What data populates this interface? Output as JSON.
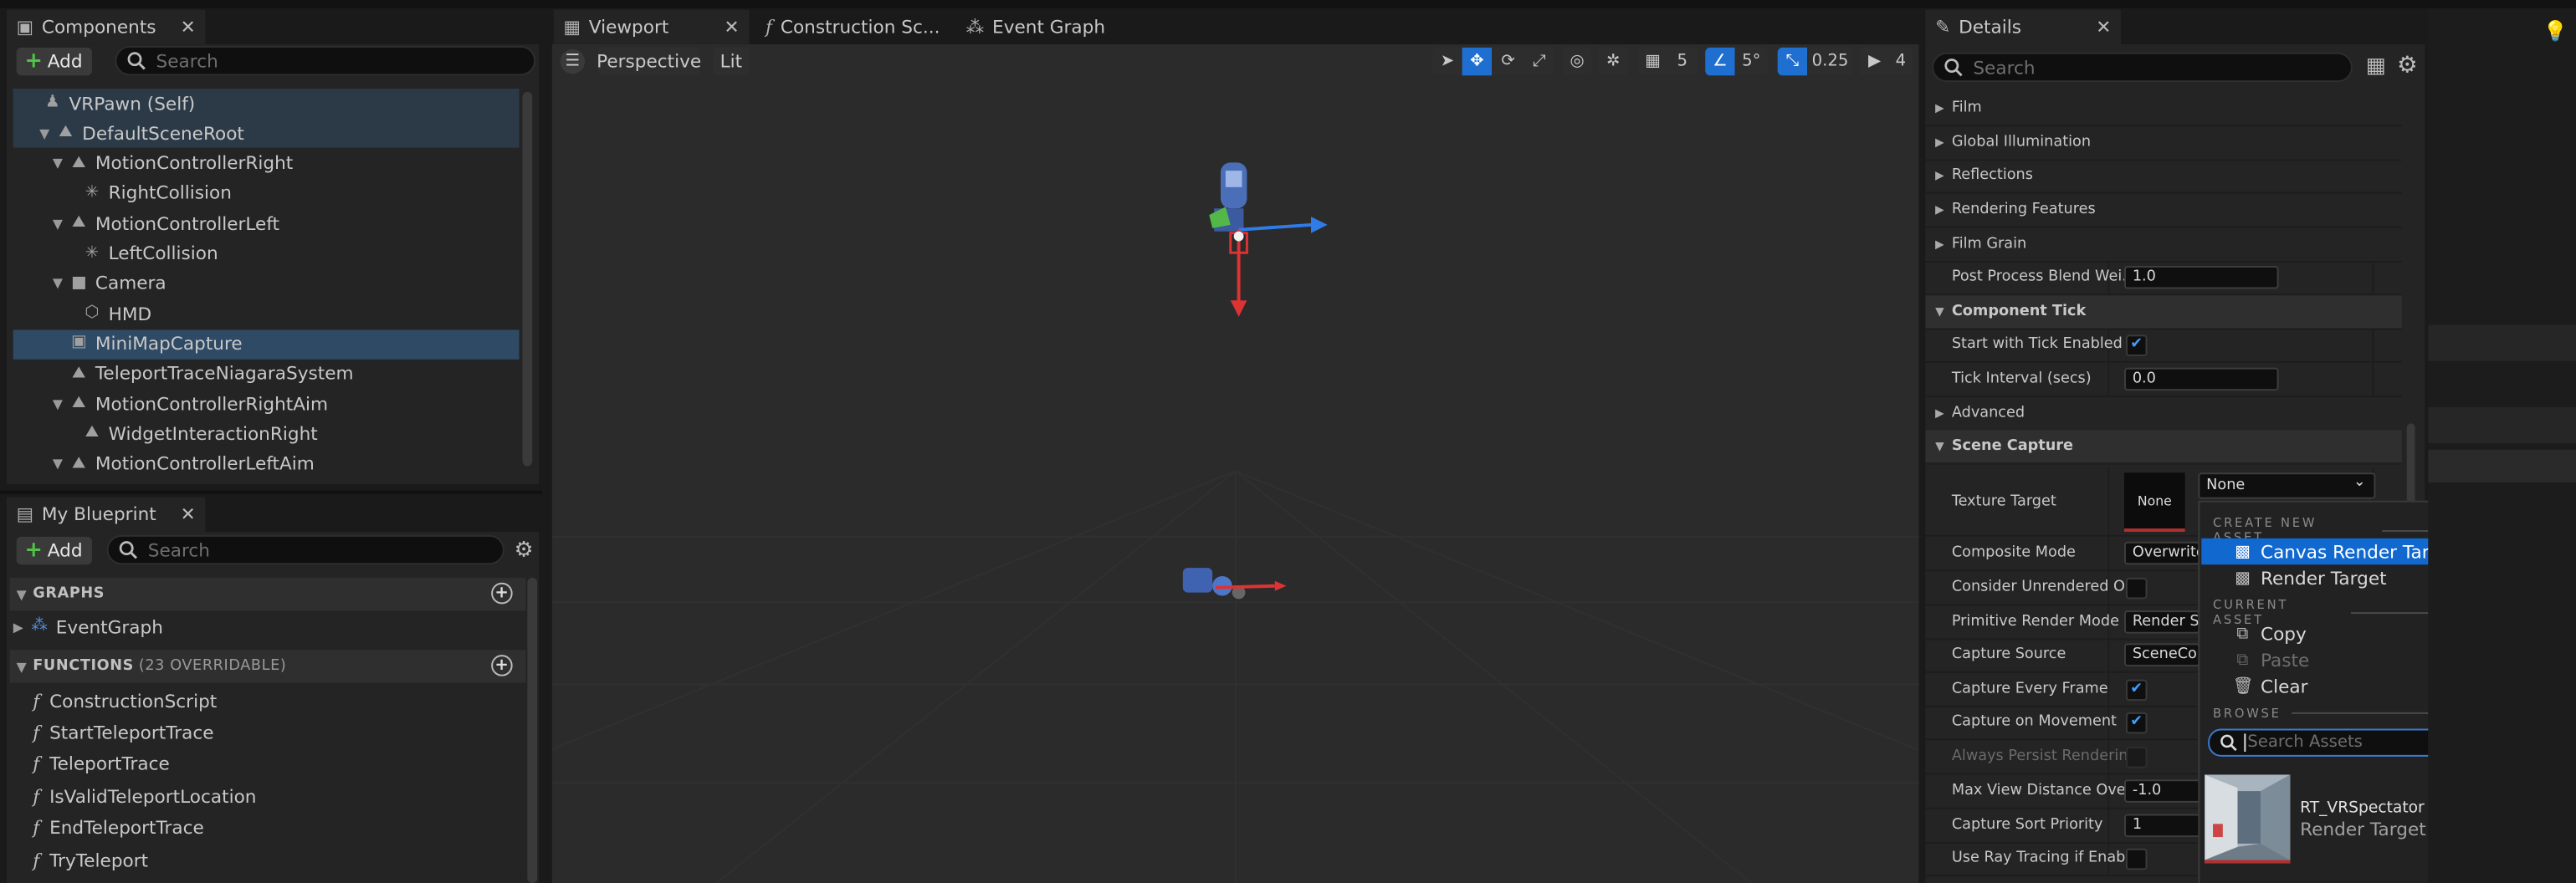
{
  "tabs": {
    "components": "Components",
    "viewport": "Viewport",
    "construction": "Construction Sc...",
    "event_graph": "Event Graph",
    "details": "Details",
    "my_blueprint": "My Blueprint"
  },
  "components_panel": {
    "add_label": "Add",
    "search_placeholder": "Search",
    "tree": [
      {
        "label": "VRPawn (Self)",
        "indent": 0,
        "icon": "pawn-icon",
        "arrow": ""
      },
      {
        "label": "DefaultSceneRoot",
        "indent": 1,
        "icon": "scene-icon",
        "arrow": "down"
      },
      {
        "label": "MotionControllerRight",
        "indent": 2,
        "icon": "motion-controller-icon",
        "arrow": "down"
      },
      {
        "label": "RightCollision",
        "indent": 3,
        "icon": "collision-icon",
        "arrow": ""
      },
      {
        "label": "MotionControllerLeft",
        "indent": 2,
        "icon": "motion-controller-icon",
        "arrow": "down"
      },
      {
        "label": "LeftCollision",
        "indent": 3,
        "icon": "collision-icon",
        "arrow": ""
      },
      {
        "label": "Camera",
        "indent": 2,
        "icon": "camera-icon",
        "arrow": "down"
      },
      {
        "label": "HMD",
        "indent": 3,
        "icon": "mesh-icon",
        "arrow": ""
      },
      {
        "label": "MiniMapCapture",
        "indent": 2,
        "icon": "scene-capture-icon",
        "arrow": "",
        "selected": true
      },
      {
        "label": "TeleportTraceNiagaraSystem",
        "indent": 2,
        "icon": "niagara-icon",
        "arrow": ""
      },
      {
        "label": "MotionControllerRightAim",
        "indent": 2,
        "icon": "motion-controller-icon",
        "arrow": "down"
      },
      {
        "label": "WidgetInteractionRight",
        "indent": 3,
        "icon": "widget-icon",
        "arrow": ""
      },
      {
        "label": "MotionControllerLeftAim",
        "indent": 2,
        "icon": "motion-controller-icon",
        "arrow": "down"
      }
    ]
  },
  "my_blueprint": {
    "add_label": "Add",
    "search_placeholder": "Search",
    "graphs_header": "GRAPHS",
    "event_graph": "EventGraph",
    "functions_header": "FUNCTIONS",
    "functions_count": "(23 OVERRIDABLE)",
    "functions": [
      "ConstructionScript",
      "StartTeleportTrace",
      "TeleportTrace",
      "IsValidTeleportLocation",
      "EndTeleportTrace",
      "TryTeleport"
    ]
  },
  "viewport": {
    "perspective": "Perspective",
    "lit": "Lit",
    "grid_value": "5",
    "angle_value": "5°",
    "scale_value": "0.25",
    "camera_speed": "4"
  },
  "details": {
    "search_placeholder": "Search",
    "rows": [
      {
        "type": "category",
        "label": "Film",
        "arrow": "right"
      },
      {
        "type": "category",
        "label": "Global Illumination",
        "arrow": "right"
      },
      {
        "type": "category",
        "label": "Reflections",
        "arrow": "right"
      },
      {
        "type": "category",
        "label": "Rendering Features",
        "arrow": "right"
      },
      {
        "type": "category",
        "label": "Film Grain",
        "arrow": "right"
      },
      {
        "type": "field",
        "label": "Post Process Blend Wei...",
        "value": "1.0"
      },
      {
        "type": "header",
        "label": "Component Tick",
        "arrow": "down"
      },
      {
        "type": "check",
        "label": "Start with Tick Enabled",
        "checked": true
      },
      {
        "type": "field",
        "label": "Tick Interval (secs)",
        "value": "0.0"
      },
      {
        "type": "category",
        "label": "Advanced",
        "arrow": "right"
      },
      {
        "type": "header",
        "label": "Scene Capture",
        "arrow": "down"
      },
      {
        "type": "texture",
        "label": "Texture Target",
        "thumb": "None",
        "value": "None"
      },
      {
        "type": "field",
        "label": "Composite Mode",
        "value": "Overwrite"
      },
      {
        "type": "check",
        "label": "Consider Unrendered O...",
        "checked": false
      },
      {
        "type": "field",
        "label": "Primitive Render Mode",
        "value": "Render Sce"
      },
      {
        "type": "field",
        "label": "Capture Source",
        "value": "SceneColo"
      },
      {
        "type": "check",
        "label": "Capture Every Frame",
        "checked": true
      },
      {
        "type": "check",
        "label": "Capture on Movement",
        "checked": true
      },
      {
        "type": "check",
        "label": "Always Persist Renderin...",
        "checked": false,
        "disabled": true
      },
      {
        "type": "field",
        "label": "Max View Distance Over...",
        "value": "-1.0"
      },
      {
        "type": "field",
        "label": "Capture Sort Priority",
        "value": "1"
      },
      {
        "type": "check",
        "label": "Use Ray Tracing if Enabl...",
        "checked": false
      }
    ]
  },
  "asset_picker": {
    "create_title": "CREATE NEW ASSET",
    "create_items": [
      "Canvas Render Target",
      "Render Target"
    ],
    "current_title": "CURRENT ASSET",
    "copy": "Copy",
    "paste": "Paste",
    "clear": "Clear",
    "browse_title": "BROWSE",
    "search_placeholder": "Search Assets",
    "asset_name": "RT_VRSpectator",
    "asset_type": "Render Target"
  },
  "colors": {
    "accent": "#1169d0",
    "selection": "#2f4a64",
    "check": "#3f9fff"
  }
}
